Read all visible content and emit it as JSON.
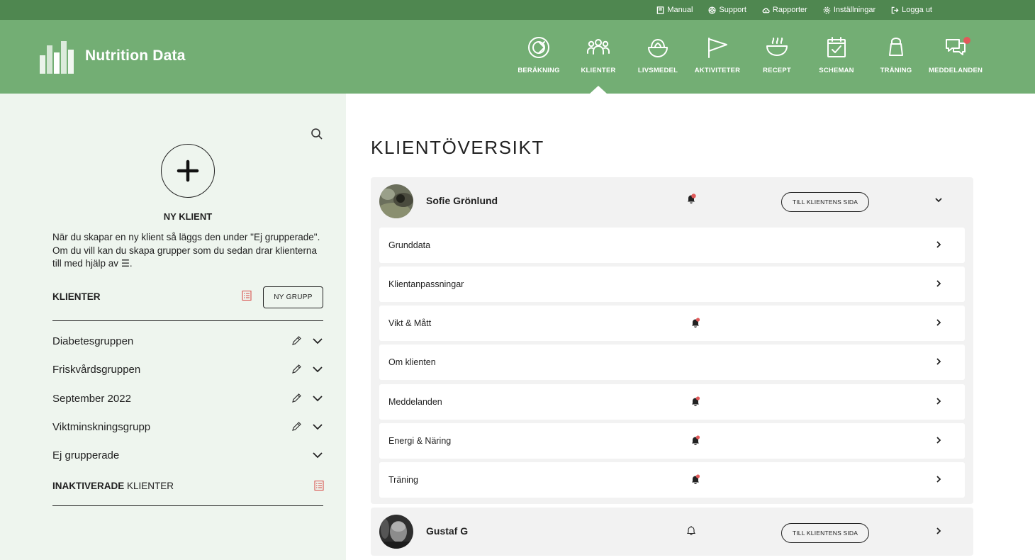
{
  "utility": {
    "links": [
      {
        "label": "Manual",
        "icon": "book-icon"
      },
      {
        "label": "Support",
        "icon": "lifebuoy-icon"
      },
      {
        "label": "Rapporter",
        "icon": "cloud-icon"
      },
      {
        "label": "Inställningar",
        "icon": "gear-icon"
      },
      {
        "label": "Logga ut",
        "icon": "logout-icon"
      }
    ]
  },
  "brand": {
    "name": "Nutrition Data"
  },
  "nav": {
    "items": [
      {
        "label": "BERÄKNING",
        "icon": "calculation-icon"
      },
      {
        "label": "KLIENTER",
        "icon": "clients-icon",
        "active": true
      },
      {
        "label": "LIVSMEDEL",
        "icon": "food-icon"
      },
      {
        "label": "AKTIVITETER",
        "icon": "flag-icon"
      },
      {
        "label": "RECEPT",
        "icon": "bowl-icon"
      },
      {
        "label": "SCHEMAN",
        "icon": "calendar-icon"
      },
      {
        "label": "TRÄNING",
        "icon": "kettlebell-icon"
      },
      {
        "label": "MEDDELANDEN",
        "icon": "chat-icon",
        "notification": true
      }
    ]
  },
  "sidebar": {
    "new_client_title": "NY KLIENT",
    "new_client_desc": "När du skapar en ny klient så läggs den under \"Ej grupperade\". Om du vill kan du skapa grupper som du sedan drar klienterna till med hjälp av",
    "drag_symbol": "☰",
    "clients_heading": "KLIENTER",
    "new_group_label": "NY GRUPP",
    "groups": [
      {
        "name": "Diabetesgruppen",
        "editable": true
      },
      {
        "name": "Friskvårdsgruppen",
        "editable": true
      },
      {
        "name": "September 2022",
        "editable": true
      },
      {
        "name": "Viktminskningsgrupp",
        "editable": true
      },
      {
        "name": "Ej grupperade",
        "editable": false
      }
    ],
    "inactive_bold": "INAKTIVERADE",
    "inactive_rest": " KLIENTER"
  },
  "main": {
    "title": "KLIENTÖVERSIKT",
    "client_page_label": "TILL KLIENTENS SIDA",
    "clients": [
      {
        "name": "Sofie Grönlund",
        "has_notification": true,
        "expanded": true,
        "sections": [
          {
            "label": "Grunddata",
            "notification": false
          },
          {
            "label": "Klientanpassningar",
            "notification": false
          },
          {
            "label": "Vikt & Mått",
            "notification": true
          },
          {
            "label": "Om klienten",
            "notification": false
          },
          {
            "label": "Meddelanden",
            "notification": true
          },
          {
            "label": "Energi & Näring",
            "notification": true
          },
          {
            "label": "Träning",
            "notification": true
          }
        ]
      },
      {
        "name": "Gustaf G",
        "has_notification": false,
        "expanded": false
      }
    ]
  },
  "colors": {
    "utility_bar": "#4f8750",
    "header": "#73ae74",
    "sidebar_bg": "#eef5ee",
    "notification_dot": "#e05a5a",
    "list_icon": "#d9534f"
  }
}
